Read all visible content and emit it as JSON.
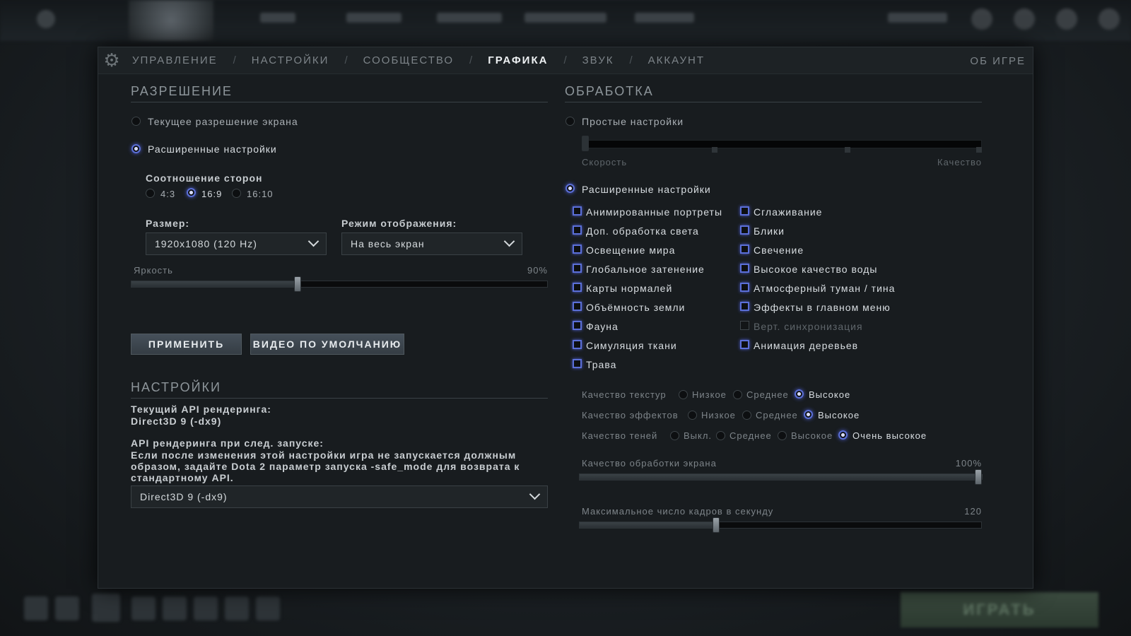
{
  "nav": {
    "items": [
      "УПРАВЛЕНИЕ",
      "НАСТРОЙКИ",
      "СООБЩЕСТВО",
      "ГРАФИКА",
      "ЗВУК",
      "АККАУНТ"
    ],
    "active_index": 3,
    "about": "ОБ ИГРЕ"
  },
  "resolution": {
    "title": "РАЗРЕШЕНИЕ",
    "current_label": "Текущее разрешение экрана",
    "advanced_label": "Расширенные настройки",
    "aspect_label": "Соотношение сторон",
    "aspect_options": [
      "4:3",
      "16:9",
      "16:10"
    ],
    "aspect_selected": "16:9",
    "size_label": "Размер:",
    "size_value": "1920x1080 (120 Hz)",
    "mode_label": "Режим отображения:",
    "mode_value": "На весь экран",
    "brightness_label": "Яркость",
    "brightness_value": "90%",
    "brightness_fraction": 0.4,
    "apply_button": "ПРИМЕНИТЬ",
    "default_button": "ВИДЕО ПО УМОЛЧАНИЮ"
  },
  "settings": {
    "title": "НАСТРОЙКИ",
    "current_api_label": "Текущий API рендеринга:",
    "current_api_value": "Direct3D 9 (-dx9)",
    "next_api_label": "API рендеринга при след. запуске:",
    "next_api_warning": "Если после изменения этой настройки игра не запускается должным образом, задайте Dota 2 параметр запуска -safe_mode для возврата к стандартному API.",
    "api_dropdown_value": "Direct3D 9 (-dx9)"
  },
  "processing": {
    "title": "ОБРАБОТКА",
    "simple_label": "Простые настройки",
    "speed_label": "Скорость",
    "quality_label": "Качество",
    "advanced_label": "Расширенные настройки",
    "checkboxes_left": [
      {
        "label": "Анимированные портреты",
        "checked": true
      },
      {
        "label": "Доп. обработка света",
        "checked": true
      },
      {
        "label": "Освещение мира",
        "checked": true
      },
      {
        "label": "Глобальное затенение",
        "checked": true
      },
      {
        "label": "Карты нормалей",
        "checked": true
      },
      {
        "label": "Объёмность земли",
        "checked": true
      },
      {
        "label": "Фауна",
        "checked": true
      },
      {
        "label": "Симуляция ткани",
        "checked": true
      },
      {
        "label": "Трава",
        "checked": true
      }
    ],
    "checkboxes_right": [
      {
        "label": "Сглаживание",
        "checked": true
      },
      {
        "label": "Блики",
        "checked": true
      },
      {
        "label": "Свечение",
        "checked": true
      },
      {
        "label": "Высокое качество воды",
        "checked": true
      },
      {
        "label": "Атмосферный туман / тина",
        "checked": true
      },
      {
        "label": "Эффекты в главном меню",
        "checked": true
      },
      {
        "label": "Верт. синхронизация",
        "checked": false
      },
      {
        "label": "Анимация деревьев",
        "checked": true
      }
    ],
    "texture_quality": {
      "label": "Качество текстур",
      "options": [
        "Низкое",
        "Среднее",
        "Высокое"
      ],
      "selected": "Высокое"
    },
    "effects_quality": {
      "label": "Качество эффектов",
      "options": [
        "Низкое",
        "Среднее",
        "Высокое"
      ],
      "selected": "Высокое"
    },
    "shadow_quality": {
      "label": "Качество теней",
      "options": [
        "Выкл.",
        "Среднее",
        "Высокое",
        "Очень высокое"
      ],
      "selected": "Очень высокое"
    },
    "screen_quality_label": "Качество обработки экрана",
    "screen_quality_value": "100%",
    "screen_quality_fraction": 1.0,
    "max_fps_label": "Максимальное число кадров в секунду",
    "max_fps_value": "120",
    "max_fps_fraction": 0.34
  },
  "background": {
    "play_button": "ИГРАТЬ"
  }
}
